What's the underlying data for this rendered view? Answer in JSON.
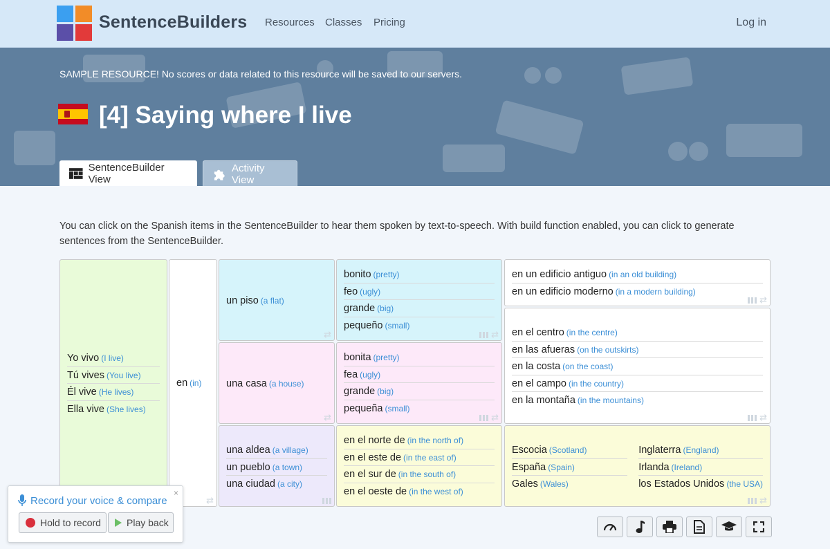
{
  "nav": {
    "brand": "SentenceBuilders",
    "links": [
      "Resources",
      "Classes",
      "Pricing"
    ],
    "login": "Log in",
    "logo_colors": [
      "#3b9ff0",
      "#f28c28",
      "#5b4fa8",
      "#e23a3a"
    ]
  },
  "hero": {
    "notice": "SAMPLE RESOURCE! No scores or data related to this resource will be saved to our servers.",
    "title": "[4] Saying where I live",
    "flag_icon": "spain-flag-icon",
    "tabs": [
      {
        "label": "SentenceBuilder View",
        "icon": "grid-icon",
        "active": true
      },
      {
        "label": "Activity View",
        "icon": "puzzle-icon",
        "active": false
      }
    ]
  },
  "intro": "You can click on the Spanish items in the SentenceBuilder to hear them spoken by text-to-speech. With build function enabled, you can click to generate sentences from the SentenceBuilder.",
  "builder": {
    "colors": {
      "green": "#e9fbd9",
      "white": "#ffffff",
      "cyan": "#d6f4fb",
      "pink": "#fde9f9",
      "lavender": "#ede9fb",
      "yellow": "#fbfcd9",
      "translation": "#3c8fd6"
    },
    "col1": [
      {
        "es": "Yo vivo",
        "en": "(I live)"
      },
      {
        "es": "Tú vives",
        "en": "(You live)"
      },
      {
        "es": "Él vive",
        "en": "(He lives)"
      },
      {
        "es": "Ella vive",
        "en": "(She lives)"
      }
    ],
    "col2": [
      {
        "es": "en",
        "en": "(in)"
      }
    ],
    "col3": {
      "flat": [
        {
          "es": "un piso",
          "en": "(a flat)"
        }
      ],
      "house": [
        {
          "es": "una casa",
          "en": "(a house)"
        }
      ],
      "place": [
        {
          "es": "una aldea",
          "en": "(a village)"
        },
        {
          "es": "un pueblo",
          "en": "(a town)"
        },
        {
          "es": "una ciudad",
          "en": "(a city)"
        }
      ]
    },
    "col4": {
      "masc": [
        {
          "es": "bonito",
          "en": "(pretty)"
        },
        {
          "es": "feo",
          "en": "(ugly)"
        },
        {
          "es": "grande",
          "en": "(big)"
        },
        {
          "es": "pequeño",
          "en": "(small)"
        }
      ],
      "fem": [
        {
          "es": "bonita",
          "en": "(pretty)"
        },
        {
          "es": "fea",
          "en": "(ugly)"
        },
        {
          "es": "grande",
          "en": "(big)"
        },
        {
          "es": "pequeña",
          "en": "(small)"
        }
      ],
      "direction": [
        {
          "es": "en el norte de",
          "en": "(in the north of)"
        },
        {
          "es": "en el este de",
          "en": "(in the east of)"
        },
        {
          "es": "en el sur de",
          "en": "(in the south of)"
        },
        {
          "es": "en el oeste de",
          "en": "(in the west of)"
        }
      ]
    },
    "col5": {
      "building": [
        {
          "es": "en un edificio antiguo",
          "en": "(in an old building)"
        },
        {
          "es": "en un edificio moderno",
          "en": "(in a modern building)"
        }
      ],
      "location": [
        {
          "es": "en el centro",
          "en": "(in the centre)"
        },
        {
          "es": "en las afueras",
          "en": "(on the outskirts)"
        },
        {
          "es": "en la costa",
          "en": "(on the coast)"
        },
        {
          "es": "en el campo",
          "en": "(in the country)"
        },
        {
          "es": "en la montaña",
          "en": "(in the mountains)"
        }
      ],
      "countries_left": [
        {
          "es": "Escocia",
          "en": "(Scotland)"
        },
        {
          "es": "España",
          "en": "(Spain)"
        },
        {
          "es": "Gales",
          "en": "(Wales)"
        }
      ],
      "countries_right": [
        {
          "es": "Inglaterra",
          "en": "(England)"
        },
        {
          "es": "Irlanda",
          "en": "(Ireland)"
        },
        {
          "es": "los Estados Unidos",
          "en": "(the USA)"
        }
      ]
    }
  },
  "toolbar": {
    "icons": [
      "speed-icon",
      "music-icon",
      "print-icon",
      "document-icon",
      "graduation-cap-icon",
      "fullscreen-icon"
    ]
  },
  "record": {
    "title": "Record your voice & compare",
    "close": "×",
    "hold": "Hold to record",
    "play": "Play back"
  }
}
